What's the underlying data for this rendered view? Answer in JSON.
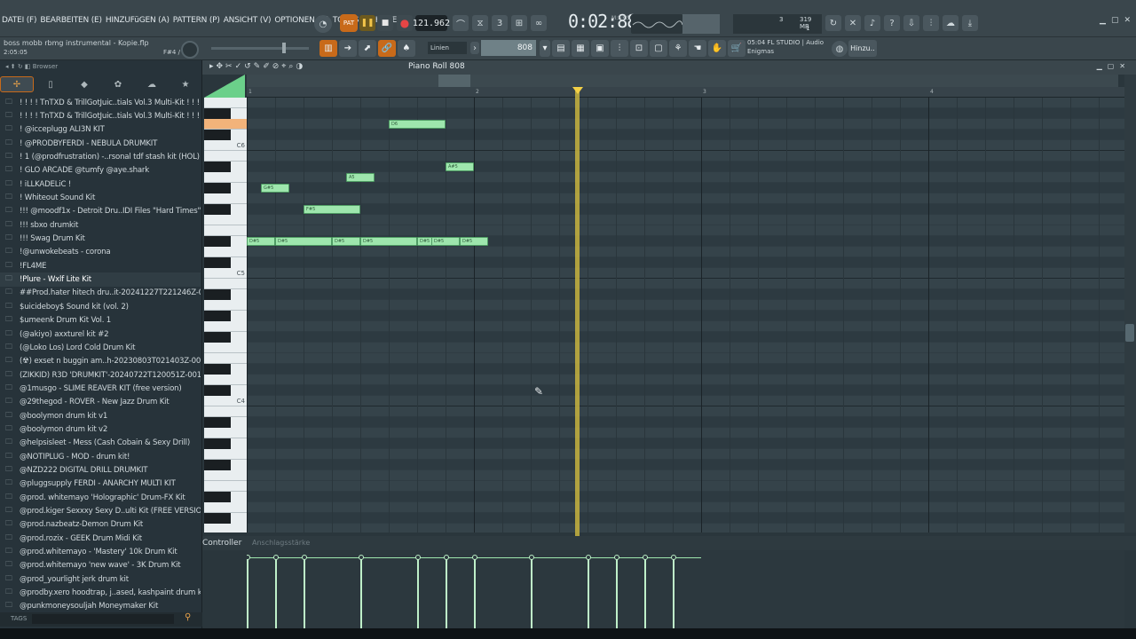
{
  "menu": [
    "DATEI (F)",
    "BEARBEITEN (E)",
    "HINZUFüGEN (A)",
    "PATTERN (P)",
    "ANSICHT (V)",
    "OPTIONEN (O)",
    "TOOLS (T)",
    "HILFE"
  ],
  "transport": {
    "pat_label": "PAT",
    "play_icon": "pause-icon",
    "tempo": "121.962",
    "time": "0:02:88",
    "time_sub": "M:S:CS"
  },
  "cpu": {
    "value": "3",
    "memory": "319 MB",
    "voices": "1"
  },
  "project": {
    "title": "boss mobb rbmg instrumental - Kopie.flp",
    "position": "2:05:05",
    "note_pos": "F#4 / 54"
  },
  "toolbar": {
    "snap_label": "Linien",
    "channel": "808",
    "hint_time": "05:04",
    "hint_line1": "FL STUDIO | Audio",
    "hint_line2": "Enigmas",
    "hinz_label": "Hinzu.."
  },
  "browser": {
    "header": "Browser",
    "tags_label": "TAGS",
    "items": [
      "! ! ! ! TnTXD & TrillGotJuic..tials Vol.3 Multi-Kit ! ! ! !",
      "! ! ! ! TnTXD & TrillGotJuic..tials Vol.3 Multi-Kit ! ! ! !_",
      "! @icceplugg ALI3N KIT",
      "! @PRODBYFERDI - NEBULA DRUMKIT",
      "! 1 (@prodfrustration) -..rsonal tdf stash kit (HOL)",
      "! GLO ARCADE @tumfy @aye.shark",
      "! iLLKADELiC !",
      "! Whiteout Sound Kit",
      "!!! @moodf1x - Detroit Dru..IDI Files \"Hard Times\"",
      "!!! sbxo drumkit",
      "!!! Swag Drum Kit",
      "!@unwokebeats - corona",
      "!FL4ME",
      "!Plure -  Wxlf Lite Kit",
      "##Prod.hater hitech dru..it-20241227T221246Z-001",
      "$uicideboy$ Sound kit (vol. 2)",
      "$umeenk Drum Kit Vol. 1",
      "(@akiyo) axxturel kit #2",
      "(@Loko Los) Lord Cold Drum Kit",
      "(☢) exset n buggin am..h-20230803T021403Z-001",
      "(ZIKKID) R3D 'DRUMKIT'-20240722T120051Z-001",
      "@1musgo - SLIME REAVER KIT (free version)",
      "@29thegod - ROVER - New Jazz Drum Kit",
      "@boolymon drum kit v1",
      "@boolymon drum kit v2",
      "@helpsisleet - Mess (Cash Cobain & Sexy Drill)",
      "@NOTIPLUG - MOD - drum kit!",
      "@NZD222 DIGITAL DRILL DRUMKIT",
      "@pluggsupply FERDI - ANARCHY MULTI KIT",
      "@prod. whitemayo 'Holographic' Drum-FX Kit",
      "@prod.kiger Sexxxy Sexy D..ulti Kit (FREE VERSION)",
      "@prod.nazbeatz-Demon Drum Kit",
      "@prod.rozix - GEEK Drum Midi Kit",
      "@prod.whitemayo - 'Mastery' 10k Drum Kit",
      "@prod.whitemayo 'new wave' - 3K Drum Kit",
      "@prod_yourlight  jerk drum kit",
      "@prodby.xero hoodtrap, j..ased, kashpaint drum kit",
      "@punkmoneysouljah Moneymaker Kit"
    ],
    "selected_index": 13
  },
  "piano_roll": {
    "title": "Piano Roll 808",
    "ruler": [
      "1",
      "2",
      "3",
      "4"
    ],
    "key_labels": [
      "C6",
      "C5",
      "C4"
    ],
    "controller_label": "Controller",
    "controller_target": "Anschlagsstärke",
    "notes": [
      {
        "label": "D#5",
        "start": 0,
        "len": 0.5,
        "row": "D#5"
      },
      {
        "label": "G#5",
        "start": 0.5,
        "len": 0.5,
        "row": "G#5"
      },
      {
        "label": "D#5",
        "start": 1,
        "len": 1,
        "row": "D#5"
      },
      {
        "label": "F#5",
        "start": 2,
        "len": 1,
        "row": "F#5"
      },
      {
        "label": "D#5",
        "start": 3,
        "len": 0.5,
        "row": "D#5"
      },
      {
        "label": "A5",
        "start": 3.5,
        "len": 0.5,
        "row": "A5"
      },
      {
        "label": "D#5",
        "start": 4,
        "len": 1,
        "row": "D#5"
      },
      {
        "label": "D6",
        "start": 5,
        "len": 1,
        "row": "D6"
      },
      {
        "label": "D#5",
        "start": 6,
        "len": 0.5,
        "row": "D#5"
      },
      {
        "label": "D#5",
        "start": 6.5,
        "len": 0.5,
        "row": "D#5"
      },
      {
        "label": "A#5",
        "start": 7,
        "len": 0.5,
        "row": "A#5"
      },
      {
        "label": "D#5",
        "start": 7.5,
        "len": 0.5,
        "row": "D#5"
      }
    ],
    "playhead_beat": 5.8
  },
  "colors": {
    "accent": "#c86a1a",
    "note": "#9ee6ad",
    "playhead": "#f3d046"
  }
}
